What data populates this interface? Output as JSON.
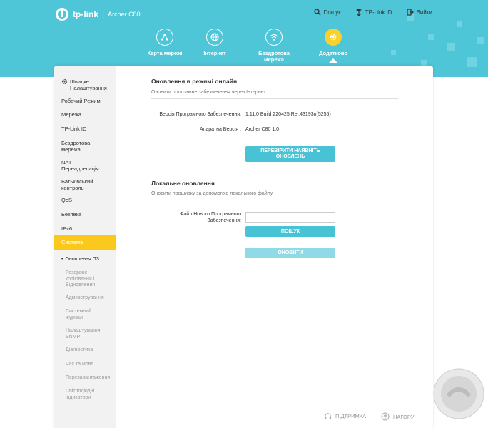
{
  "header": {
    "brand": "tp-link",
    "separator": "|",
    "model": "Archer C80",
    "links": [
      {
        "label": "Пошук",
        "icon": "search-icon"
      },
      {
        "label": "TP-Link ID",
        "icon": "user-icon"
      },
      {
        "label": "Вийти",
        "icon": "logout-icon"
      }
    ],
    "nav": [
      {
        "label": "Карта мережі",
        "icon": "network-map-icon"
      },
      {
        "label": "Інтернет",
        "icon": "globe-icon"
      },
      {
        "label": "Бездротова мережа",
        "icon": "wireless-icon"
      },
      {
        "label": "Додатково",
        "icon": "gear-icon",
        "active": true
      }
    ]
  },
  "sidebar": {
    "items": [
      "Швидке Налаштування",
      "Робочий Режим",
      "Мережа",
      "TP-Link ID",
      "Бездротова мережа",
      "NAT Переадресація",
      "Батьківський контроль",
      "QoS",
      "Безпека",
      "IPv6",
      "Система"
    ],
    "active_index": 10,
    "sub_items": [
      "Оновлення ПЗ",
      "Резервне копіювання і Відновлення",
      "Адміністрування",
      "Системний журнал",
      "Налаштування SNMP",
      "Діагностика",
      "Час та мова",
      "Перезавантаження",
      "Світлодіодні індикатори"
    ],
    "current_sub_index": 0
  },
  "online": {
    "title": "Оновлення в режимі онлайн",
    "desc": "Оновити програмне забезпечення через Інтернет",
    "firmware_label": "Версія Програмного Забезпечення:",
    "firmware_value": "1.11.0 Build 220425 Rel.43193n(5255)",
    "hardware_label": "Апаратна Версія :",
    "hardware_value": "Archer C80 1.0",
    "check_button": "ПЕРЕВІРИТИ НАЯВНІТЬ ОНОВЛЕНЬ"
  },
  "local": {
    "title": "Локальне оновлення",
    "desc": "Оновити прошивку за допомогою локального файлу.",
    "file_label": "Файл Нового Програмного Забезпечення:",
    "file_value": "",
    "browse_button": "ПОШУК",
    "upgrade_button": "ОНОВИТИ"
  },
  "footer": {
    "support": "ПІДТРИМКА",
    "top": "НАГОРУ"
  },
  "colors": {
    "header": "#4ec6d8",
    "accent": "#fbc91e",
    "button": "#48c3d6"
  }
}
